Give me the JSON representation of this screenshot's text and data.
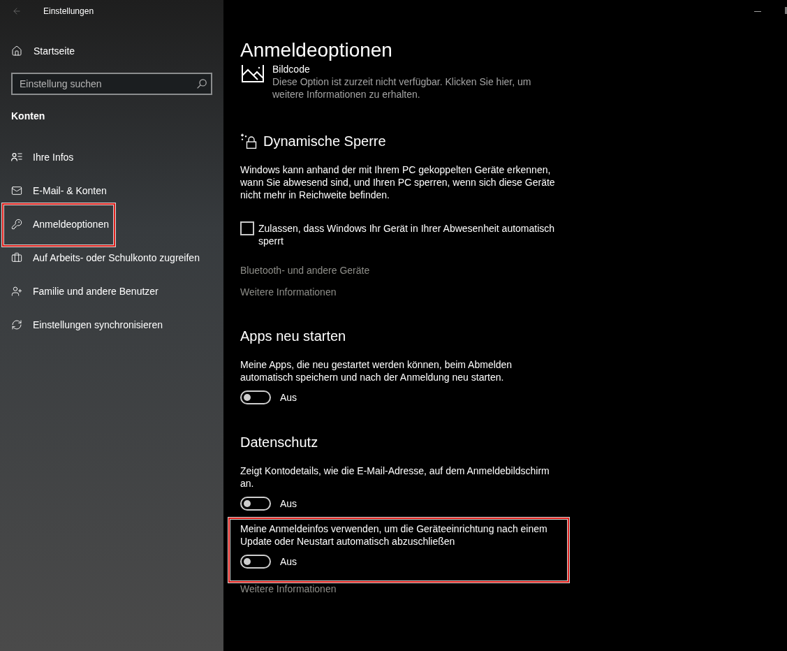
{
  "window": {
    "title": "Einstellungen"
  },
  "sidebar": {
    "home": "Startseite",
    "search": {
      "placeholder": "Einstellung suchen"
    },
    "section": "Konten",
    "items": [
      {
        "label": "Ihre Infos",
        "highlighted": false
      },
      {
        "label": "E-Mail- & Konten",
        "highlighted": false
      },
      {
        "label": "Anmeldeoptionen",
        "highlighted": true
      },
      {
        "label": "Auf Arbeits- oder Schulkonto zugreifen",
        "highlighted": false
      },
      {
        "label": "Familie und andere Benutzer",
        "highlighted": false
      },
      {
        "label": "Einstellungen synchronisieren",
        "highlighted": false
      }
    ]
  },
  "page": {
    "title": "Anmeldeoptionen",
    "picture_password": {
      "label": "Bildcode",
      "description": "Diese Option ist zurzeit nicht verfügbar. Klicken Sie hier, um weitere Informationen zu erhalten."
    },
    "sections": [
      {
        "heading": "Dynamische Sperre",
        "blocks": [
          {
            "kind": "text",
            "text": "Windows kann anhand der mit Ihrem PC gekoppelten Geräte erkennen, wann Sie abwesend sind, und Ihren PC sperren, wenn sich diese Geräte nicht mehr in Reichweite befinden."
          },
          {
            "kind": "checkbox",
            "label": "Zulassen, dass Windows Ihr Gerät in Ihrer Abwesenheit automatisch sperrt",
            "checked": false
          },
          {
            "kind": "link",
            "text": "Bluetooth- und andere Geräte"
          },
          {
            "kind": "link",
            "text": "Weitere Informationen"
          }
        ]
      },
      {
        "heading": "Apps neu starten",
        "blocks": [
          {
            "kind": "toggle",
            "description": "Meine Apps, die neu gestartet werden können, beim Abmelden automatisch speichern und nach der Anmeldung neu starten.",
            "on": false,
            "state_label": "Aus",
            "highlighted": false
          }
        ]
      },
      {
        "heading": "Datenschutz",
        "blocks": [
          {
            "kind": "toggle",
            "description": "Zeigt Kontodetails, wie die E-Mail-Adresse, auf dem Anmeldebildschirm an.",
            "on": false,
            "state_label": "Aus",
            "highlighted": false
          },
          {
            "kind": "toggle",
            "description": "Meine Anmeldeinfos verwenden, um die Geräteeinrichtung nach einem Update oder Neustart automatisch abzuschließen",
            "on": false,
            "state_label": "Aus",
            "highlighted": true
          },
          {
            "kind": "link",
            "text": "Weitere Informationen"
          }
        ]
      }
    ]
  }
}
